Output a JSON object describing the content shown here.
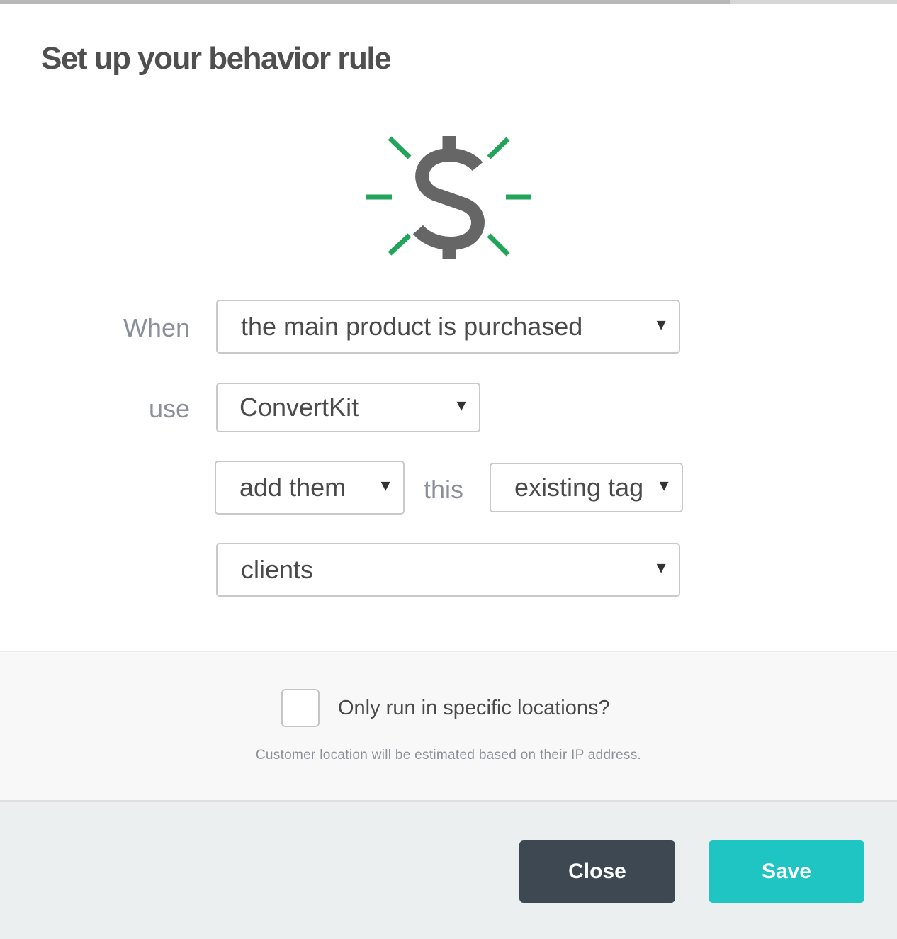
{
  "modal": {
    "title": "Set up your behavior rule"
  },
  "icon": {
    "name": "dollar-burst-icon",
    "glyph_color": "#666666",
    "ray_color": "#22a55a"
  },
  "rule": {
    "when_label": "When",
    "trigger_value": "the main product is purchased",
    "use_label": "use",
    "integration_value": "ConvertKit",
    "action_value": "add them",
    "this_label": "this",
    "tag_type_value": "existing tag",
    "tag_value": "clients"
  },
  "location": {
    "checkbox_label": "Only run in specific locations?",
    "checked": false,
    "helper_text": "Customer location will be estimated based on their IP address."
  },
  "footer": {
    "close_label": "Close",
    "save_label": "Save"
  },
  "colors": {
    "save_button": "#1ec5c3",
    "close_button": "#3d4852"
  }
}
